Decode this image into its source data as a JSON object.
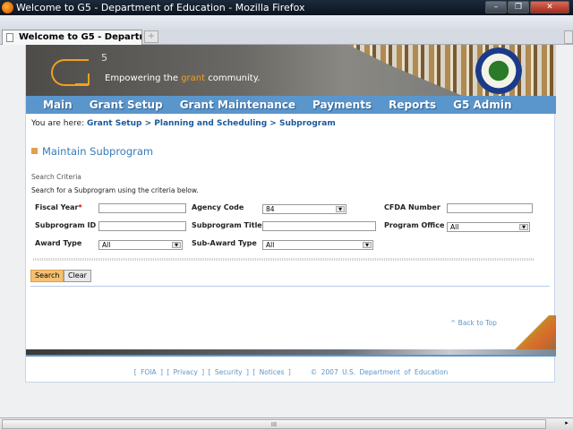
{
  "window": {
    "title": "Welcome to G5 - Department of Education - Mozilla Firefox",
    "tab_label": "Welcome to G5 - Departmen...",
    "new_tab": "+",
    "min": "–",
    "max": "❐",
    "close": "✕"
  },
  "banner": {
    "logo_sup": "5",
    "tagline_pre": "Empowering the ",
    "tagline_hl": "grant",
    "tagline_post": " community."
  },
  "nav": [
    "Main",
    "Grant Setup",
    "Grant Maintenance",
    "Payments",
    "Reports",
    "G5 Admin"
  ],
  "breadcrumb": {
    "prefix": "You are here: ",
    "items": [
      "Grant Setup",
      "Planning and Scheduling",
      "Subprogram"
    ],
    "sep": " > "
  },
  "page_title": "Maintain Subprogram",
  "search": {
    "section": "Search Criteria",
    "instructions": "Search for a Subprogram using the criteria below.",
    "fiscal_year": {
      "label": "Fiscal Year",
      "required": "*",
      "value": ""
    },
    "agency_code": {
      "label": "Agency Code",
      "value": "84"
    },
    "cfda_number": {
      "label": "CFDA Number",
      "value": ""
    },
    "subprogram_id": {
      "label": "Subprogram ID",
      "value": ""
    },
    "subprogram_title": {
      "label": "Subprogram Title",
      "value": ""
    },
    "program_office": {
      "label": "Program Office",
      "value": "All"
    },
    "award_type": {
      "label": "Award Type",
      "value": "All"
    },
    "sub_award_type": {
      "label": "Sub-Award Type",
      "value": "All"
    },
    "search_btn": "Search",
    "clear_btn": "Clear"
  },
  "back_to_top": "^ Back to Top",
  "footer": {
    "links": [
      "FOIA",
      "Privacy",
      "Security",
      "Notices"
    ],
    "copyright": "© 2007 U.S. Department of Education"
  },
  "scrollbar": {
    "grip": "III",
    "arrow": "▸"
  }
}
